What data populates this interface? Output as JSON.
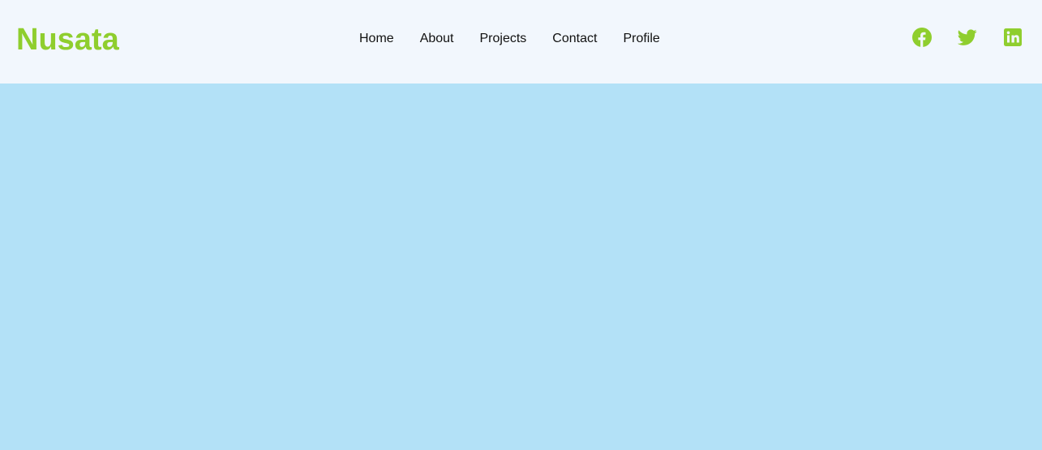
{
  "header": {
    "logo": "Nusata",
    "nav": [
      {
        "label": "Home"
      },
      {
        "label": "About"
      },
      {
        "label": "Projects"
      },
      {
        "label": "Contact"
      },
      {
        "label": "Profile"
      }
    ],
    "social": [
      {
        "icon": "facebook-icon"
      },
      {
        "icon": "twitter-icon"
      },
      {
        "icon": "linkedin-icon"
      }
    ]
  },
  "colors": {
    "accent": "#8fce2e",
    "header_bg": "#f2f7fd",
    "page_bg": "#b3e1f7",
    "nav_text": "#111111"
  }
}
